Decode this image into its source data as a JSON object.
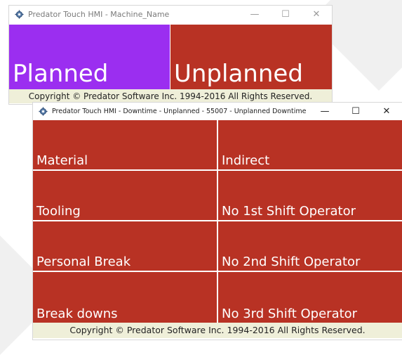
{
  "window1": {
    "title": "Predator Touch HMI - Machine_Name",
    "buttons": [
      {
        "label": "Planned",
        "color": "#9b2ef0"
      },
      {
        "label": "Unplanned",
        "color": "#b83224"
      }
    ],
    "footer": "Copyright © Predator Software Inc. 1994-2016 All Rights Reserved."
  },
  "window2": {
    "title": "Predator Touch HMI - Downtime - Unplanned - 55007 - Unplanned Downtime",
    "reasons": [
      "Material",
      "Indirect",
      "Tooling",
      "No 1st Shift Operator",
      "Personal Break",
      "No 2nd Shift Operator",
      "Break downs",
      "No 3rd Shift Operator"
    ],
    "tile_color": "#b83224",
    "footer": "Copyright © Predator Software Inc. 1994-2016 All Rights Reserved."
  },
  "window_controls": {
    "minimize": "—",
    "maximize": "☐",
    "close": "✕"
  },
  "icons": {
    "app": "gear-icon"
  }
}
